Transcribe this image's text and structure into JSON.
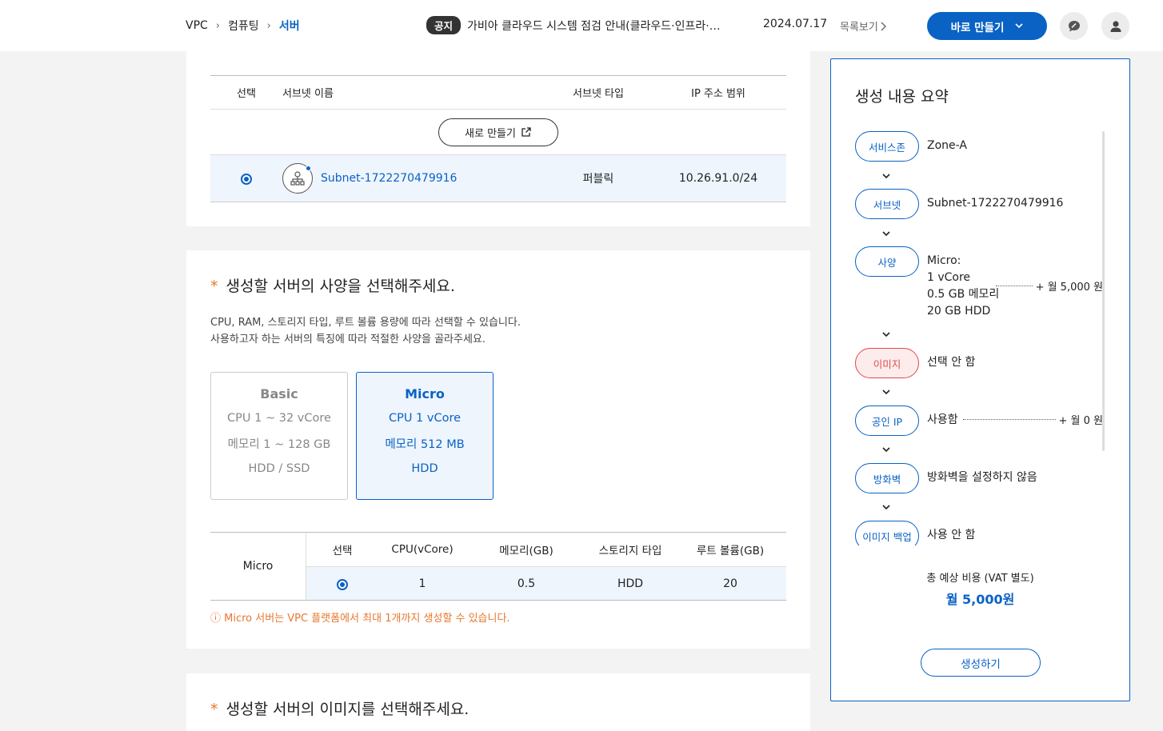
{
  "breadcrumb": {
    "items": [
      "VPC",
      "컴퓨팅",
      "서버"
    ]
  },
  "notice": {
    "tag": "공지",
    "text": "가비아 클라우드 시스템 점검 안내(클라우드·인프라·…",
    "date": "2024.07.17",
    "list_link": "목록보기"
  },
  "header": {
    "quick_create_label": "바로 만들기"
  },
  "subnet_section": {
    "columns": [
      "선택",
      "서브넷 이름",
      "서브넷 타입",
      "IP 주소 범위"
    ],
    "new_button_label": "새로 만들기",
    "rows": [
      {
        "name": "Subnet-1722270479916",
        "type": "퍼블릭",
        "ip_range": "10.26.91.0/24"
      }
    ]
  },
  "spec_section": {
    "title": "생성할 서버의 사양을 선택해주세요.",
    "description_line1": "CPU, RAM, 스토리지 타입, 루트 볼륨 용량에 따라 선택할 수 있습니다.",
    "description_line2": "사용하고자 하는 서버의 특징에 따라 적절한 사양을 골라주세요.",
    "cards": [
      {
        "name": "Basic",
        "cpu": "CPU 1 ~ 32 vCore",
        "memory": "메모리 1 ~ 128 GB",
        "storage": "HDD / SSD"
      },
      {
        "name": "Micro",
        "cpu": "CPU 1 vCore",
        "memory": "메모리 512 MB",
        "storage": "HDD"
      }
    ],
    "table": {
      "row_label": "Micro",
      "columns": [
        "선택",
        "CPU(vCore)",
        "메모리(GB)",
        "스토리지 타입",
        "루트 볼륨(GB)"
      ],
      "values": {
        "cpu": "1",
        "memory": "0.5",
        "storage": "HDD",
        "root_volume": "20"
      }
    },
    "warning": "ⓘ Micro 서버는 VPC 플랫폼에서 최대 1개까지 생성할 수 있습니다."
  },
  "image_section": {
    "title": "생성할 서버의 이미지를 선택해주세요."
  },
  "summary": {
    "title": "생성 내용 요약",
    "items": [
      {
        "label": "서비스존",
        "value": "Zone-A"
      },
      {
        "label": "서브넷",
        "value": "Subnet-1722270479916"
      },
      {
        "label": "사양",
        "value_lines": [
          "Micro:",
          "1 vCore",
          "0.5 GB 메모리",
          "20 GB HDD"
        ],
        "price": "+ 월 5,000 원"
      },
      {
        "label": "이미지",
        "value": "선택 안 함"
      },
      {
        "label": "공인 IP",
        "value": "사용함",
        "price": "+ 월 0 원"
      },
      {
        "label": "방화벽",
        "value": "방화벽을 설정하지 않음"
      },
      {
        "label": "이미지 백업",
        "value": "사용 안 함"
      }
    ],
    "total_label": "총 예상 비용 (VAT 별도)",
    "total_value": "월 5,000원",
    "create_button": "생성하기"
  },
  "colors": {
    "accent": "#0a62c4",
    "warning": "#e8772e",
    "error": "#e04848",
    "selected_bg": "#eef5fd"
  }
}
